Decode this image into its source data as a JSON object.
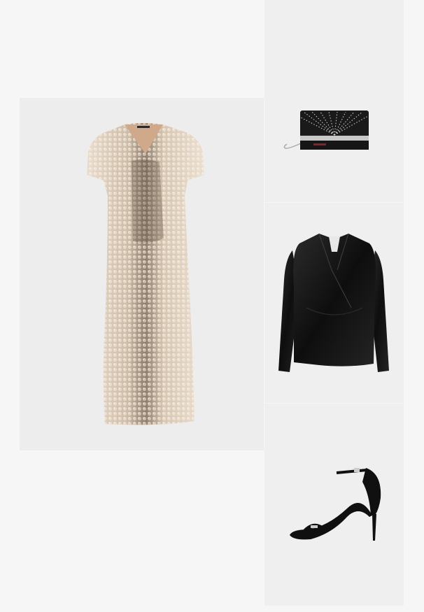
{
  "collage": {
    "background": "#f6f6f6",
    "tile_background": "#efefef",
    "items": [
      {
        "name": "sequin-dress",
        "colors": {
          "base": "#d8c8b4",
          "sequin_light": "#f2e8dc",
          "sequin_dark": "#7a6a5a",
          "skin": "#cfa98a"
        }
      },
      {
        "name": "clutch-bag",
        "colors": {
          "body": "#1a1a1a",
          "studs": "#d9d9d9",
          "trim": "#c8c8c8",
          "chain": "#aaaaaa"
        }
      },
      {
        "name": "velvet-blazer",
        "colors": {
          "body": "#111111",
          "sheen": "#2b2b2b",
          "lining": "#e8e8e8"
        }
      },
      {
        "name": "strappy-heels",
        "colors": {
          "body": "#101010",
          "buckle": "#cccccc",
          "insole": "#202020"
        }
      }
    ]
  }
}
